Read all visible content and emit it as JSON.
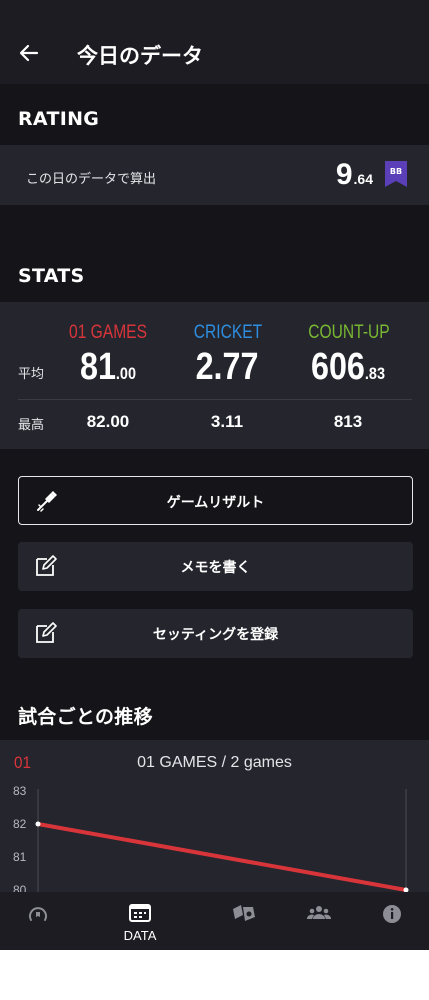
{
  "header": {
    "title": "今日のデータ"
  },
  "rating": {
    "section_title": "RATING",
    "label": "この日のデータで算出",
    "value_int": "9",
    "value_dec": ".64",
    "flag": "BB",
    "flag_color": "#5a3fb8"
  },
  "stats": {
    "section_title": "STATS",
    "columns": [
      {
        "name": "01 GAMES",
        "color": "#d8353b",
        "avg_int": "81",
        "avg_dec": ".00",
        "max": "82.00"
      },
      {
        "name": "CRICKET",
        "color": "#2e8ee0",
        "avg_int": "2.77",
        "avg_dec": "",
        "max": "3.11"
      },
      {
        "name": "COUNT-UP",
        "color": "#79b832",
        "avg_int": "606",
        "avg_dec": ".83",
        "max": "813"
      }
    ],
    "avg_label": "平均",
    "max_label": "最高"
  },
  "actions": [
    {
      "label": "ゲームリザルト",
      "icon": "dart-icon"
    },
    {
      "label": "メモを書く",
      "icon": "edit-icon"
    },
    {
      "label": "セッティングを登録",
      "icon": "edit-icon"
    }
  ],
  "trend": {
    "section_title": "試合ごとの推移",
    "badge": "01",
    "chart_title": "01 GAMES / 2 games"
  },
  "chart_data": {
    "type": "line",
    "title": "01 GAMES / 2 games",
    "x": [
      1,
      2
    ],
    "series": [
      {
        "values": [
          82,
          80
        ],
        "color": "#d8353b"
      }
    ],
    "ylim": [
      80,
      83
    ],
    "yticks": [
      "83",
      "82",
      "81",
      "80"
    ],
    "grid": false
  },
  "nav": {
    "items": [
      {
        "label": "",
        "icon": "rating-gauge-icon"
      },
      {
        "label": "DATA",
        "icon": "data-calendar-icon",
        "active": true
      },
      {
        "label": "",
        "icon": "award-icon"
      },
      {
        "label": "",
        "icon": "friends-icon"
      },
      {
        "label": "",
        "icon": "info-icon"
      }
    ]
  }
}
